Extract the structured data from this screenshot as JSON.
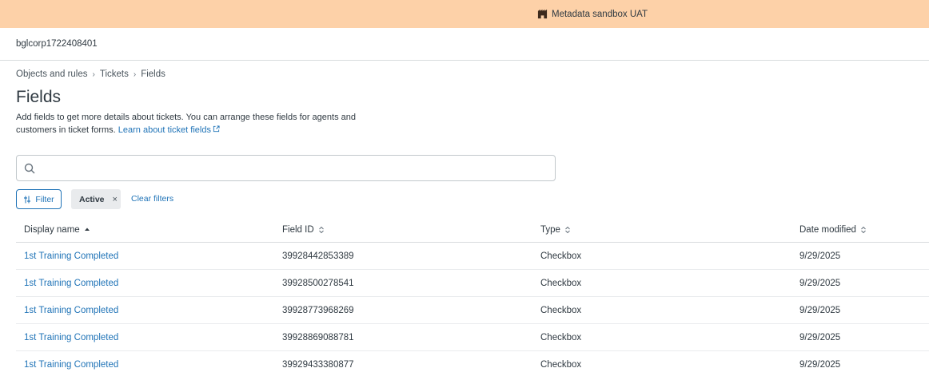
{
  "banner": {
    "label": "Metadata sandbox UAT",
    "icon": "building-icon",
    "color": "#fdd1a8"
  },
  "account": {
    "name": "bglcorp1722408401"
  },
  "breadcrumb": {
    "items": [
      "Objects and rules",
      "Tickets",
      "Fields"
    ]
  },
  "page": {
    "title": "Fields",
    "description": "Add fields to get more details about tickets. You can arrange these fields for agents and customers in ticket forms.",
    "learn_link": "Learn about ticket fields"
  },
  "search": {
    "value": "",
    "placeholder": ""
  },
  "filters": {
    "filter_label": "Filter",
    "active_chip": "Active",
    "chip_remove": "×",
    "clear_label": "Clear filters"
  },
  "table": {
    "columns": [
      {
        "label": "Display name",
        "sort": "ascending"
      },
      {
        "label": "Field ID",
        "sort": "none"
      },
      {
        "label": "Type",
        "sort": "none"
      },
      {
        "label": "Date modified",
        "sort": "none"
      }
    ],
    "rows": [
      {
        "name": "1st Training Completed",
        "id": "39928442853389",
        "type": "Checkbox",
        "date": "9/29/2025"
      },
      {
        "name": "1st Training Completed",
        "id": "39928500278541",
        "type": "Checkbox",
        "date": "9/29/2025"
      },
      {
        "name": "1st Training Completed",
        "id": "39928773968269",
        "type": "Checkbox",
        "date": "9/29/2025"
      },
      {
        "name": "1st Training Completed",
        "id": "39928869088781",
        "type": "Checkbox",
        "date": "9/29/2025"
      },
      {
        "name": "1st Training Completed",
        "id": "39929433380877",
        "type": "Checkbox",
        "date": "9/29/2025"
      }
    ]
  },
  "colors": {
    "link": "#1f73b7",
    "text": "#2f3941",
    "border": "#d8dcde"
  }
}
